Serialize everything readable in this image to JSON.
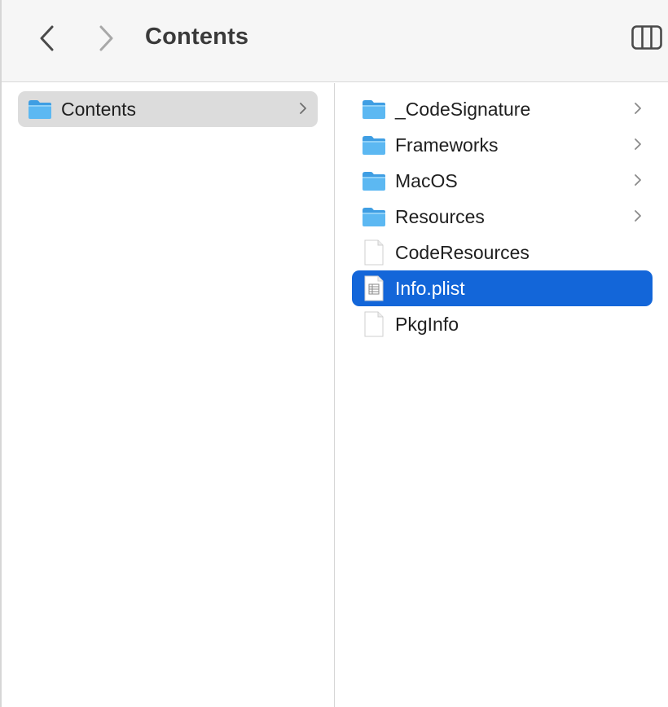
{
  "window": {
    "title": "Contents"
  },
  "toolbar": {
    "back_icon": "chevron-left-icon",
    "forward_icon": "chevron-right-icon",
    "view_icon": "columns-view-icon"
  },
  "columns": [
    {
      "items": [
        {
          "label": "Contents",
          "kind": "folder",
          "has_children": true,
          "state": "selected-inactive"
        }
      ]
    },
    {
      "items": [
        {
          "label": "_CodeSignature",
          "kind": "folder",
          "has_children": true,
          "state": ""
        },
        {
          "label": "Frameworks",
          "kind": "folder",
          "has_children": true,
          "state": ""
        },
        {
          "label": "MacOS",
          "kind": "folder",
          "has_children": true,
          "state": ""
        },
        {
          "label": "Resources",
          "kind": "folder",
          "has_children": true,
          "state": ""
        },
        {
          "label": "CodeResources",
          "kind": "document",
          "has_children": false,
          "state": ""
        },
        {
          "label": "Info.plist",
          "kind": "plist",
          "has_children": false,
          "state": "selected-active"
        },
        {
          "label": "PkgInfo",
          "kind": "document",
          "has_children": false,
          "state": ""
        }
      ]
    }
  ],
  "colors": {
    "selection_active": "#1366d9",
    "selection_inactive": "#dcdcdc",
    "folder_blue": "#5cb8f2"
  }
}
